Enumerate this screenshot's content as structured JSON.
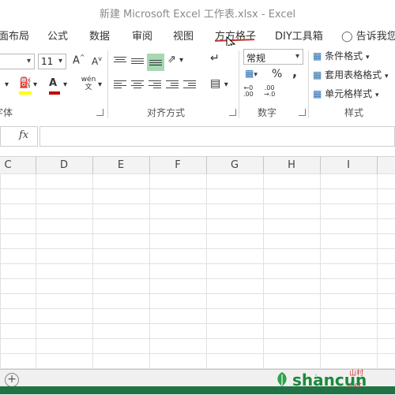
{
  "window": {
    "title": "新建 Microsoft Excel 工作表.xlsx - Excel"
  },
  "tabs": [
    {
      "label": "面布局"
    },
    {
      "label": "公式"
    },
    {
      "label": "数据"
    },
    {
      "label": "审阅"
    },
    {
      "label": "视图"
    },
    {
      "label": "方方格子"
    },
    {
      "label": "DIY工具箱"
    },
    {
      "label": "告诉我您想"
    }
  ],
  "ribbon": {
    "font": {
      "size_value": "11",
      "group_label": "字体",
      "phonetic_label": "wén 文"
    },
    "alignment": {
      "group_label": "对齐方式"
    },
    "number": {
      "format_value": "常规",
      "group_label": "数字",
      "percent": "%",
      "comma": ","
    },
    "styles": {
      "group_label": "样式",
      "conditional_format": "条件格式",
      "table_format": "套用表格格式",
      "cell_styles": "单元格样式"
    }
  },
  "formula_bar": {
    "fx_label": "fx",
    "value": ""
  },
  "columns": [
    "C",
    "D",
    "E",
    "F",
    "G",
    "H",
    "I"
  ],
  "sheet": {
    "add_label": "+"
  },
  "watermark": {
    "text": "shancun",
    "suffix": "山村",
    "net": ".net"
  },
  "colors": {
    "accent": "#217346",
    "selected": "#a6d8b4",
    "underline": "#c0392b"
  }
}
